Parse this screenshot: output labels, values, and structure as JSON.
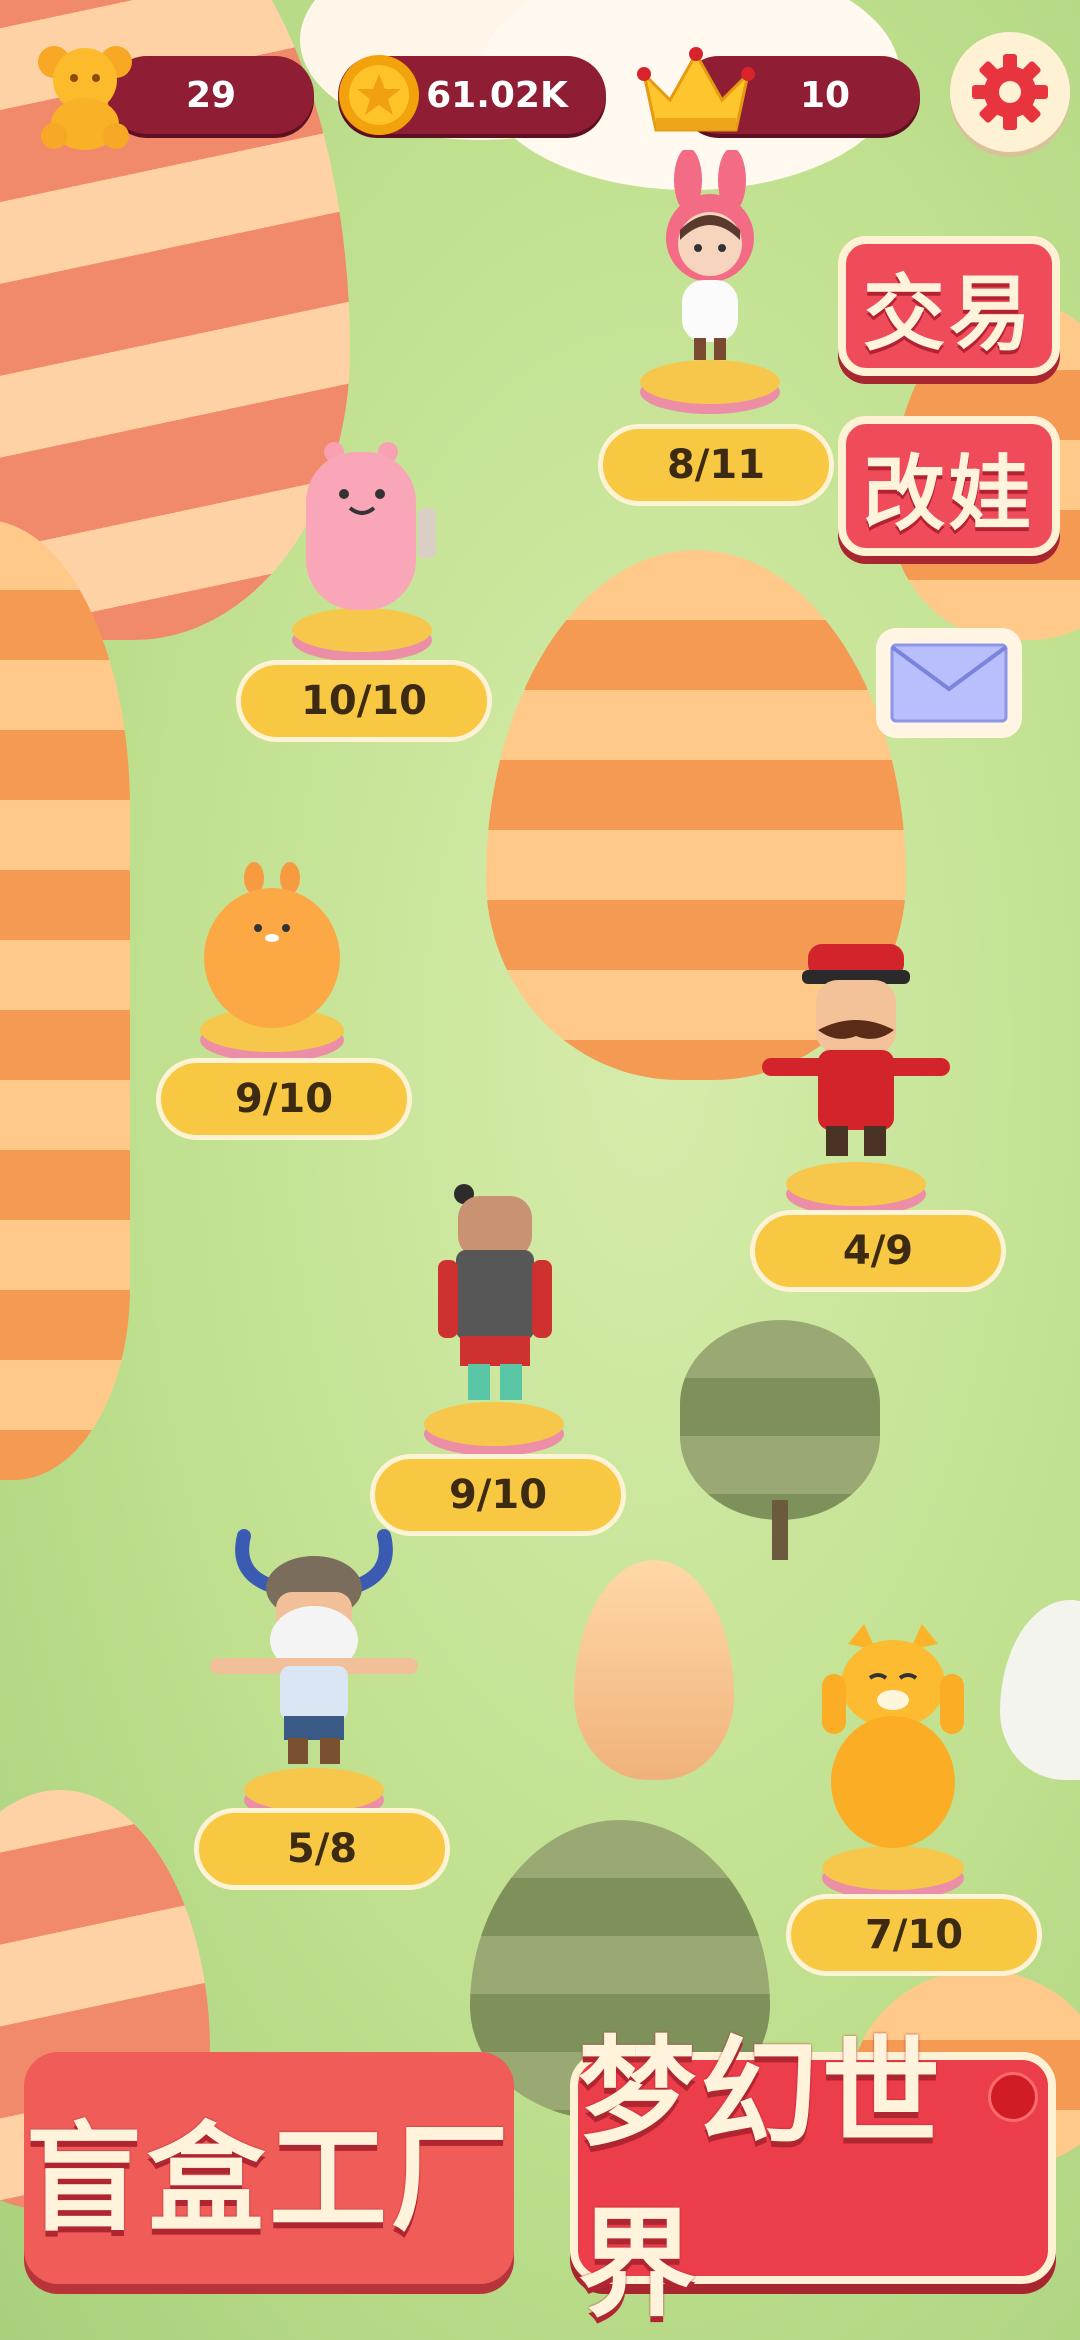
{
  "stats": {
    "bears": "29",
    "coins": "61.02K",
    "crowns": "10"
  },
  "icons": {
    "bear": "gummy-bear-icon",
    "coin": "gold-coin-icon",
    "crown": "crown-icon",
    "settings": "gear-icon",
    "mail": "envelope-icon"
  },
  "side_buttons": {
    "trade": "交易",
    "modify": "改娃"
  },
  "figures": [
    {
      "name": "bunny-hood-girl",
      "progress": "8/11"
    },
    {
      "name": "pink-windup-toy",
      "progress": "10/10"
    },
    {
      "name": "orange-bunny-blob",
      "progress": "9/10"
    },
    {
      "name": "mustache-conductor",
      "progress": "4/9"
    },
    {
      "name": "terracotta-warrior",
      "progress": "9/10"
    },
    {
      "name": "viking-dwarf",
      "progress": "5/8"
    },
    {
      "name": "yellow-cat",
      "progress": "7/10"
    }
  ],
  "bottom_buttons": {
    "factory": "盲盒工厂",
    "world": "梦幻世界"
  },
  "colors": {
    "stat_bg": "#8f1d33",
    "label_bg": "#f9c842",
    "button_red": "#ef4b5a",
    "cream": "#fff1d4"
  }
}
